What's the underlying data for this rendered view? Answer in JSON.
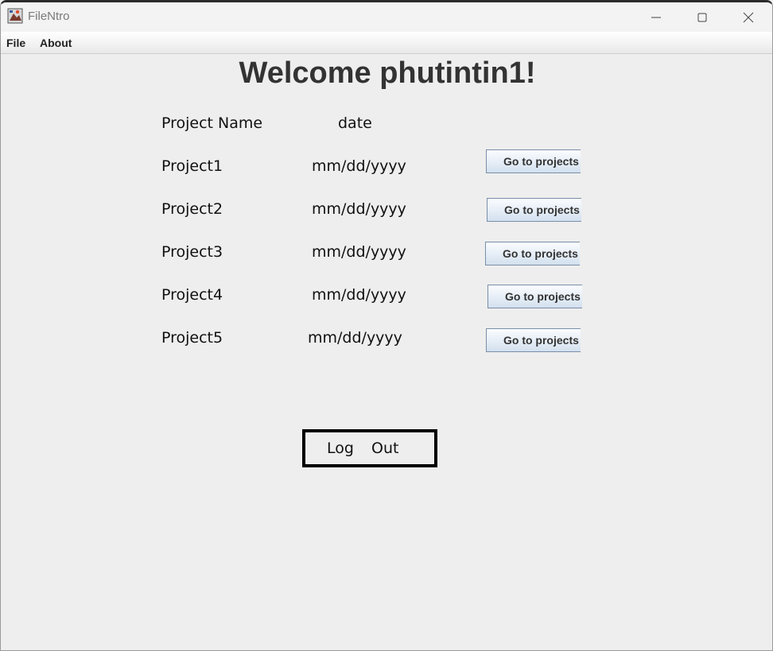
{
  "window": {
    "title": "FileNtro",
    "controls": [
      "minimize-icon",
      "maximize-icon",
      "close-icon"
    ]
  },
  "menu": {
    "file": "File",
    "about": "About"
  },
  "welcome": "Welcome phutintin1!",
  "table": {
    "headers": {
      "name": "Project Name",
      "date": "date"
    },
    "rows": [
      {
        "name": "Project1",
        "date": "mm/dd/yyyy",
        "button": "Go to projects"
      },
      {
        "name": "Project2",
        "date": "mm/dd/yyyy",
        "button": "Go to projects"
      },
      {
        "name": "Project3",
        "date": "mm/dd/yyyy",
        "button": "Go to projects"
      },
      {
        "name": "Project4",
        "date": "mm/dd/yyyy",
        "button": "Go to projects"
      },
      {
        "name": "Project5",
        "date": "mm/dd/yyyy",
        "button": "Go to projects"
      }
    ]
  },
  "logout": {
    "word1": "Log",
    "word2": "Out"
  }
}
